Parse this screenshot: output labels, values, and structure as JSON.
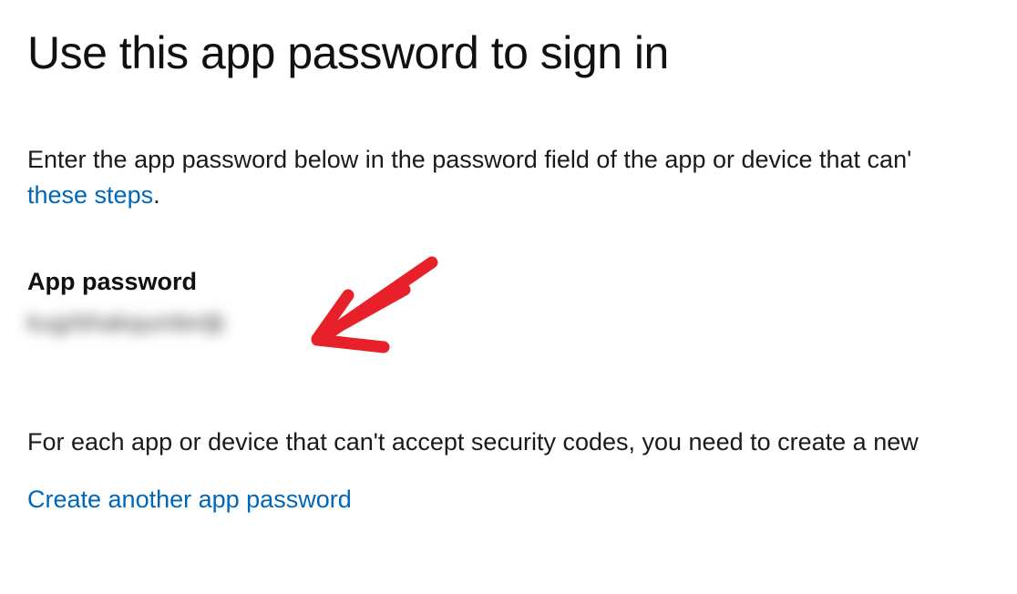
{
  "title": "Use this app password to sign in",
  "instruction": {
    "text_before_link": "Enter the app password below in the password field of the app or device that can'",
    "link_text": "these steps",
    "text_after_link": "."
  },
  "password_section": {
    "label": "App password",
    "value": "kugrbhakqumbrdjt"
  },
  "footer_text": "For each app or device that can't accept security codes, you need to create a new",
  "create_link": "Create another app password"
}
